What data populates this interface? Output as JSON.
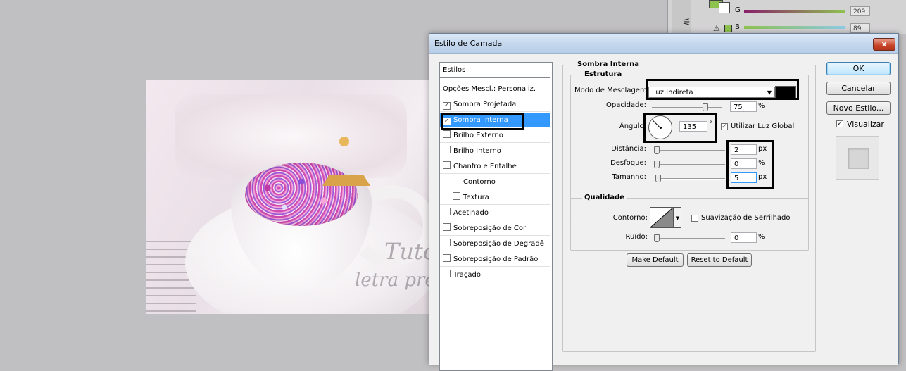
{
  "background_panel": {
    "label_g": "G",
    "label_b": "B",
    "value_g": "209",
    "value_b": "89"
  },
  "canvas": {
    "watermark_line1": "Tuto",
    "watermark_line2": "letra pres"
  },
  "dialog": {
    "title": "Estilo de Camada",
    "close_label": "x",
    "styles_header": "Estilos",
    "blend_options_label": "Opções Mescl.: Personaliz.",
    "style_items": [
      {
        "label": "Sombra Projetada",
        "checked": true
      },
      {
        "label": "Sombra Interna",
        "checked": true
      },
      {
        "label": "Brilho Externo",
        "checked": false
      },
      {
        "label": "Brilho Interno",
        "checked": false
      },
      {
        "label": "Chanfro e Entalhe",
        "checked": false
      },
      {
        "label": "Contorno",
        "checked": false
      },
      {
        "label": "Textura",
        "checked": false
      },
      {
        "label": "Acetinado",
        "checked": false
      },
      {
        "label": "Sobreposição de Cor",
        "checked": false
      },
      {
        "label": "Sobreposição de Degradê",
        "checked": false
      },
      {
        "label": "Sobreposição de Padrão",
        "checked": false
      },
      {
        "label": "Traçado",
        "checked": false
      }
    ],
    "check_mark": "✓",
    "section_title": "Sombra Interna",
    "structure_title": "Estrutura",
    "blend_mode_label": "Modo de Mesclagem:",
    "blend_mode_value": "Luz Indireta",
    "blend_color": "#000000",
    "opacity_label": "Opacidade:",
    "opacity_value": "75",
    "opacity_level": 75,
    "percent": "%",
    "angle_label": "Ângulo:",
    "angle_value": "135",
    "angle_unit": "°",
    "global_light_label": "Utilizar Luz Global",
    "distance_label": "Distância:",
    "distance_value": "2",
    "choke_label": "Desfoque:",
    "choke_value": "0",
    "size_label": "Tamanho:",
    "size_value": "5",
    "px": "px",
    "quality_title": "Qualidade",
    "contour_label": "Contorno:",
    "antialias_label": "Suavização de Serrilhado",
    "noise_label": "Ruído:",
    "noise_value": "0",
    "make_default": "Make Default",
    "reset_default": "Reset to Default",
    "ok": "OK",
    "cancel": "Cancelar",
    "new_style": "Novo Estilo...",
    "preview_label": "Visualizar",
    "highlight_color": "#000000",
    "selection_color": "#3399ff"
  }
}
